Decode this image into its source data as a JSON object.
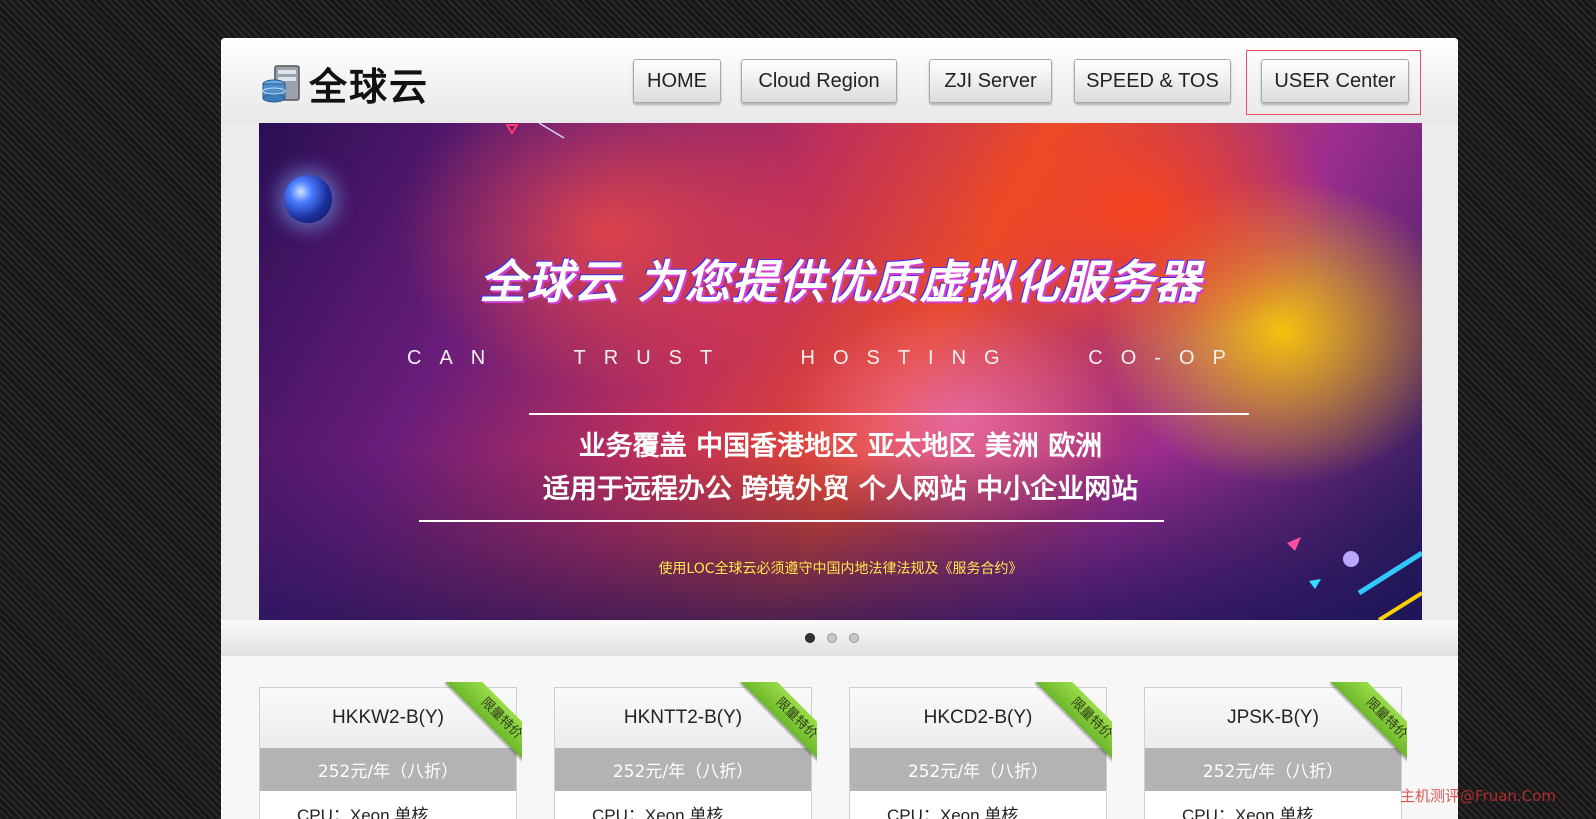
{
  "logo": {
    "text": "全球云"
  },
  "nav": {
    "items": [
      {
        "label": "HOME"
      },
      {
        "label": "Cloud Region"
      },
      {
        "label": "ZJI Server"
      },
      {
        "label": "SPEED & TOS"
      },
      {
        "label": "USER Center"
      }
    ],
    "active": "USER Center"
  },
  "banner": {
    "title": "全球云  为您提供优质虚拟化服务器",
    "subtitle": "CAN   TRUST   HOSTING   CO-OP",
    "line1": "业务覆盖 中国香港地区 亚太地区 美洲 欧洲",
    "line2": "适用于远程办公  跨境外贸  个人网站  中小企业网站",
    "note": "使用LOC全球云必须遵守中国内地法律法规及《服务合约》"
  },
  "carousel": {
    "dot_count": 3,
    "active_index": 0
  },
  "products": [
    {
      "name": "HKKW2-B(Y)",
      "price": "252元/年（八折）",
      "spec": "CPU：Xeon 单核",
      "badge": "限量特价"
    },
    {
      "name": "HKNTT2-B(Y)",
      "price": "252元/年（八折）",
      "spec": "CPU：Xeon 单核",
      "badge": "限量特价"
    },
    {
      "name": "HKCD2-B(Y)",
      "price": "252元/年（八折）",
      "spec": "CPU：Xeon 单核",
      "badge": "限量特价"
    },
    {
      "name": "JPSK-B(Y)",
      "price": "252元/年（八折）",
      "spec": "CPU：Xeon 单核",
      "badge": "限量特价"
    }
  ],
  "watermark": "主机测评@Fruan.Com",
  "colors": {
    "active_frame": "#e0505e",
    "ribbon": "#8ccf3f",
    "price_bar": "#b3b3b3"
  }
}
